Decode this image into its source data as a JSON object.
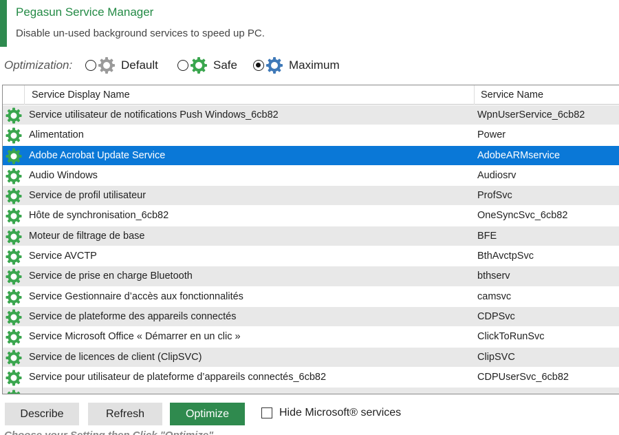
{
  "header": {
    "title": "Pegasun Service Manager",
    "subtitle": "Disable un-used background services to speed up PC."
  },
  "optimization": {
    "label": "Optimization:",
    "options": [
      {
        "label": "Default",
        "checked": false,
        "icon": "gear-gray-icon"
      },
      {
        "label": "Safe",
        "checked": false,
        "icon": "gear-green-icon"
      },
      {
        "label": "Maximum",
        "checked": true,
        "icon": "gear-blue-icon"
      }
    ]
  },
  "grid": {
    "columns": {
      "display_name": "Service Display Name",
      "service_name": "Service Name"
    },
    "selected_index": 2,
    "rows": [
      {
        "display_name": "Service utilisateur de notifications Push Windows_6cb82",
        "service_name": "WpnUserService_6cb82"
      },
      {
        "display_name": "Alimentation",
        "service_name": "Power"
      },
      {
        "display_name": "Adobe Acrobat Update Service",
        "service_name": "AdobeARMservice"
      },
      {
        "display_name": "Audio Windows",
        "service_name": "Audiosrv"
      },
      {
        "display_name": "Service de profil utilisateur",
        "service_name": "ProfSvc"
      },
      {
        "display_name": "Hôte de synchronisation_6cb82",
        "service_name": "OneSyncSvc_6cb82"
      },
      {
        "display_name": "Moteur de filtrage de base",
        "service_name": "BFE"
      },
      {
        "display_name": "Service AVCTP",
        "service_name": "BthAvctpSvc"
      },
      {
        "display_name": "Service de prise en charge Bluetooth",
        "service_name": "bthserv"
      },
      {
        "display_name": "Service Gestionnaire d’accès aux fonctionnalités",
        "service_name": "camsvc"
      },
      {
        "display_name": "Service de plateforme des appareils connectés",
        "service_name": "CDPSvc"
      },
      {
        "display_name": "Service Microsoft Office « Démarrer en un clic »",
        "service_name": "ClickToRunSvc"
      },
      {
        "display_name": "Service de licences de client (ClipSVC)",
        "service_name": "ClipSVC"
      },
      {
        "display_name": "Service pour utilisateur de plateforme d’appareils connectés_6cb82",
        "service_name": "CDPUserSvc_6cb82"
      },
      {
        "display_name": "",
        "service_name": ""
      }
    ]
  },
  "actions": {
    "describe": "Describe",
    "refresh": "Refresh",
    "optimize": "Optimize",
    "hide_microsoft": "Hide Microsoft® services"
  },
  "hint": "Choose your Setting then Click \"Optimize\"",
  "colors": {
    "accent": "#2f8a4e",
    "selection": "#0a78d7",
    "row_alt": "#e8e8e8"
  }
}
